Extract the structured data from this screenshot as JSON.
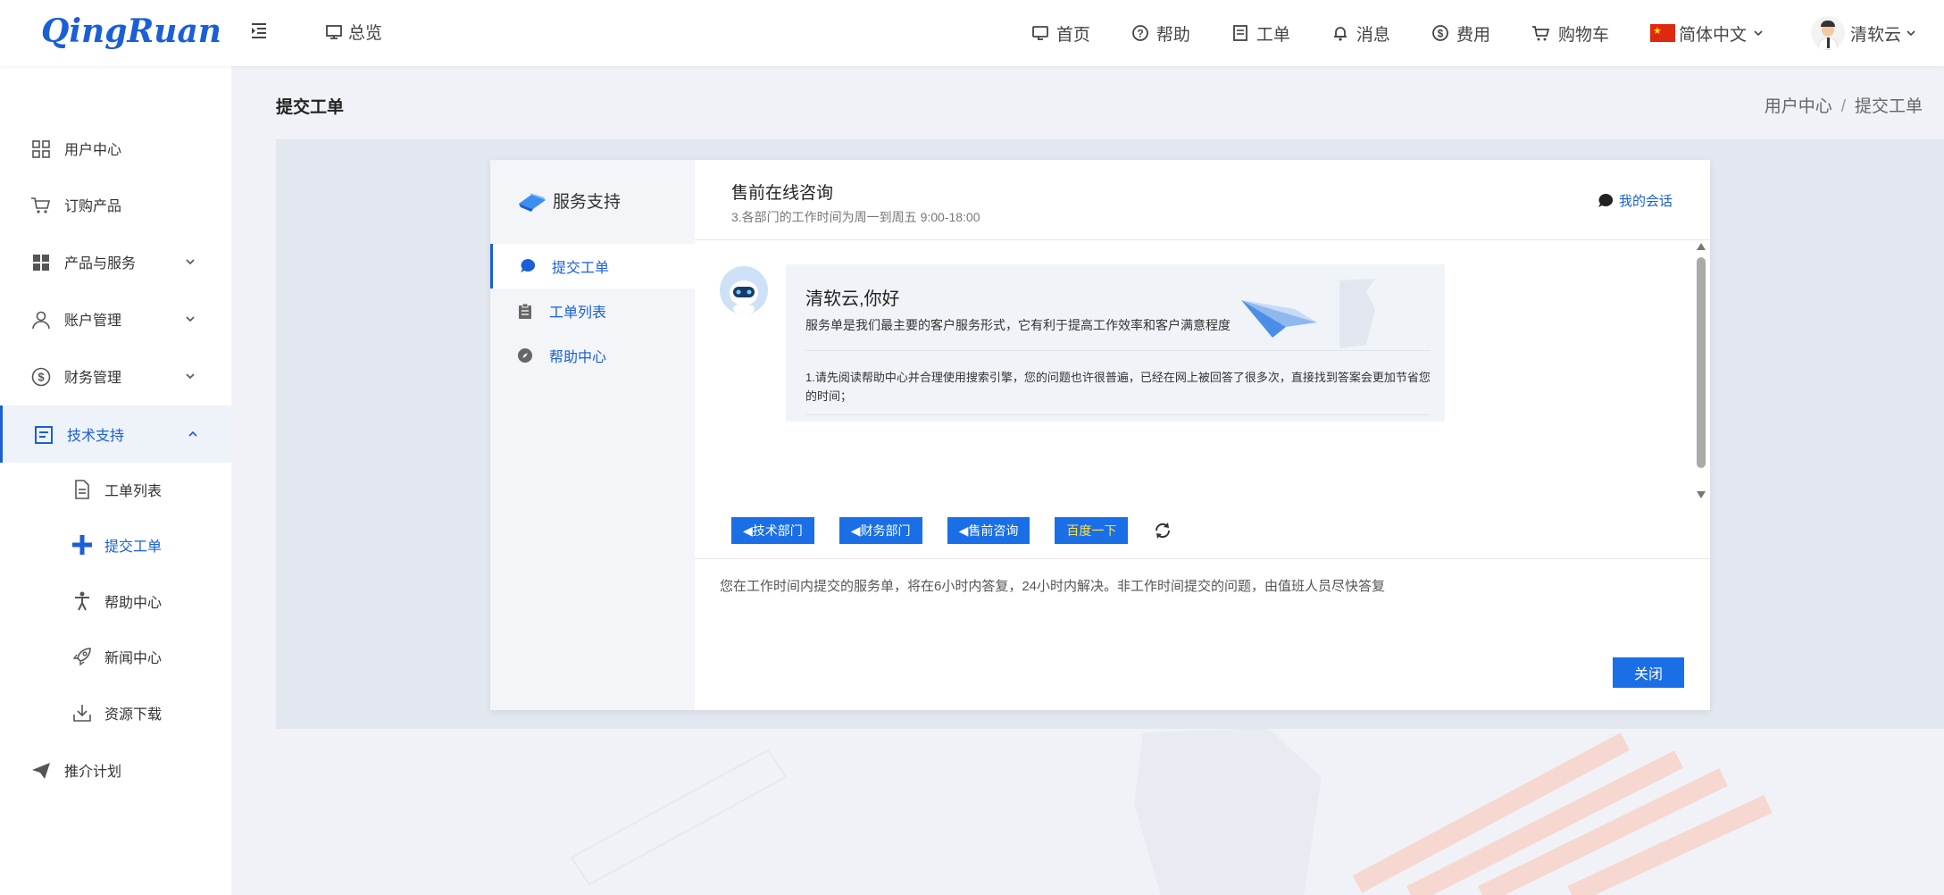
{
  "header": {
    "logo": "QingRuan",
    "overview": "总览",
    "nav": [
      {
        "label": "首页",
        "icon": "home-icon"
      },
      {
        "label": "帮助",
        "icon": "help-icon"
      },
      {
        "label": "工单",
        "icon": "ticket-icon"
      },
      {
        "label": "消息",
        "icon": "bell-icon"
      },
      {
        "label": "费用",
        "icon": "dollar-icon"
      },
      {
        "label": "购物车",
        "icon": "cart-icon"
      }
    ],
    "language": "简体中文",
    "user": "清软云"
  },
  "sidebar": {
    "items": [
      {
        "label": "用户中心",
        "icon": "grid-icon"
      },
      {
        "label": "订购产品",
        "icon": "cart-icon"
      },
      {
        "label": "产品与服务",
        "icon": "apps-icon"
      },
      {
        "label": "账户管理",
        "icon": "user-icon"
      },
      {
        "label": "财务管理",
        "icon": "dollar-icon"
      },
      {
        "label": "技术支持",
        "icon": "doc-icon"
      }
    ],
    "sub_items": [
      {
        "label": "工单列表",
        "icon": "file-icon"
      },
      {
        "label": "提交工单",
        "icon": "plus-icon"
      },
      {
        "label": "帮助中心",
        "icon": "person-icon"
      },
      {
        "label": "新闻中心",
        "icon": "rocket-icon"
      },
      {
        "label": "资源下载",
        "icon": "download-icon"
      }
    ],
    "bottom_item": {
      "label": "推介计划",
      "icon": "send-icon"
    }
  },
  "page": {
    "title": "提交工单",
    "breadcrumb": [
      "用户中心",
      "提交工单"
    ]
  },
  "dialog": {
    "service_title": "服务支持",
    "menu": [
      {
        "label": "提交工单",
        "icon": "chat-icon"
      },
      {
        "label": "工单列表",
        "icon": "clipboard-icon"
      },
      {
        "label": "帮助中心",
        "icon": "compass-icon"
      }
    ],
    "title": "售前在线咨询",
    "subtitle": "3.各部门的工作时间为周一到周五 9:00-18:00",
    "my_session": "我的会话",
    "greeting": "清软云,你好",
    "intro": "服务单是我们最主要的客户服务形式，它有利于提高工作效率和客户满意程度",
    "tip": "1.请先阅读帮助中心并合理使用搜索引擎，您的问题也许很普遍，已经在网上被回答了很多次，直接找到答案会更加节省您的时间；",
    "quick_buttons": [
      "技术部门",
      "财务部门",
      "售前咨询"
    ],
    "baidu_button": "百度一下",
    "notice": "您在工作时间内提交的服务单，将在6小时内答复，24小时内解决。非工作时间提交的问题，由值班人员尽快答复",
    "close_button": "关闭"
  },
  "colors": {
    "accent": "#1a5fd6",
    "button": "#1a6fe6",
    "baidu_text": "#ffe14a"
  }
}
